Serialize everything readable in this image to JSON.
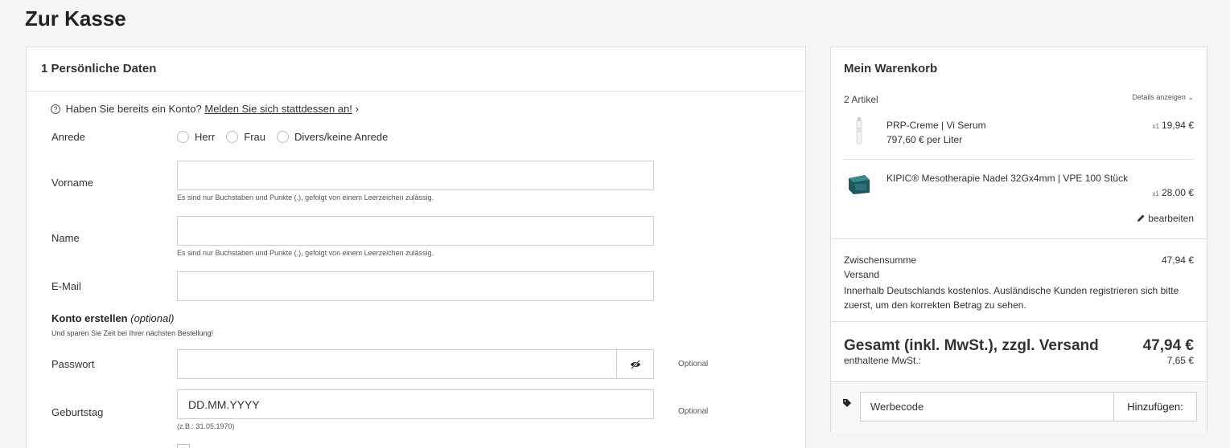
{
  "page": {
    "title": "Zur Kasse"
  },
  "personal": {
    "section_title": "1 Persönliche Daten",
    "login_hint": {
      "text": "Haben Sie bereits ein Konto?",
      "link": "Melden Sie sich stattdessen an!",
      "chevron": "›"
    },
    "salutation": {
      "label": "Anrede",
      "options": [
        "Herr",
        "Frau",
        "Divers/keine Anrede"
      ]
    },
    "first_name": {
      "label": "Vorname",
      "value": "",
      "hint": "Es sind nur Buchstaben und Punkte (.), gefolgt von einem Leerzeichen zulässig."
    },
    "last_name": {
      "label": "Name",
      "value": "",
      "hint": "Es sind nur Buchstaben und Punkte (.), gefolgt von einem Leerzeichen zulässig."
    },
    "email": {
      "label": "E-Mail",
      "value": ""
    },
    "account": {
      "title": "Konto erstellen",
      "optional_suffix": "(optional)",
      "subtitle": "Und sparen Sie Zeit bei Ihrer nächsten Bestellung!"
    },
    "password": {
      "label": "Passwort",
      "value": "",
      "optional": "Optional"
    },
    "birthday": {
      "label": "Geburtstag",
      "placeholder": "DD.MM.YYYY",
      "example": "(z.B.: 31.05.1970)",
      "optional": "Optional"
    }
  },
  "cart": {
    "title": "Mein Warenkorb",
    "count": "2 Artikel",
    "details_link": "Details anzeigen",
    "items": [
      {
        "name": "PRP-Creme | Vi Serum",
        "unit_price": "797,60 € per Liter",
        "qty": "x1",
        "price": "19,94 €"
      },
      {
        "name": "KIPIC® Mesotherapie Nadel 32Gx4mm | VPE 100 Stück",
        "qty": "x1",
        "price": "28,00 €"
      }
    ],
    "edit_label": "bearbeiten",
    "subtotal_label": "Zwischensumme",
    "subtotal_value": "47,94 €",
    "shipping_label": "Versand",
    "shipping_note": "Innerhalb Deutschlands kostenlos. Ausländische Kunden registrieren sich bitte zuerst, um den korrekten Betrag zu sehen.",
    "total_label": "Gesamt (inkl. MwSt.), zzgl. Versand",
    "total_value": "47,94 €",
    "vat_label": "enthaltene MwSt.:",
    "vat_value": "7,65 €",
    "promo": {
      "placeholder": "Werbecode",
      "button": "Hinzufügen:"
    }
  }
}
